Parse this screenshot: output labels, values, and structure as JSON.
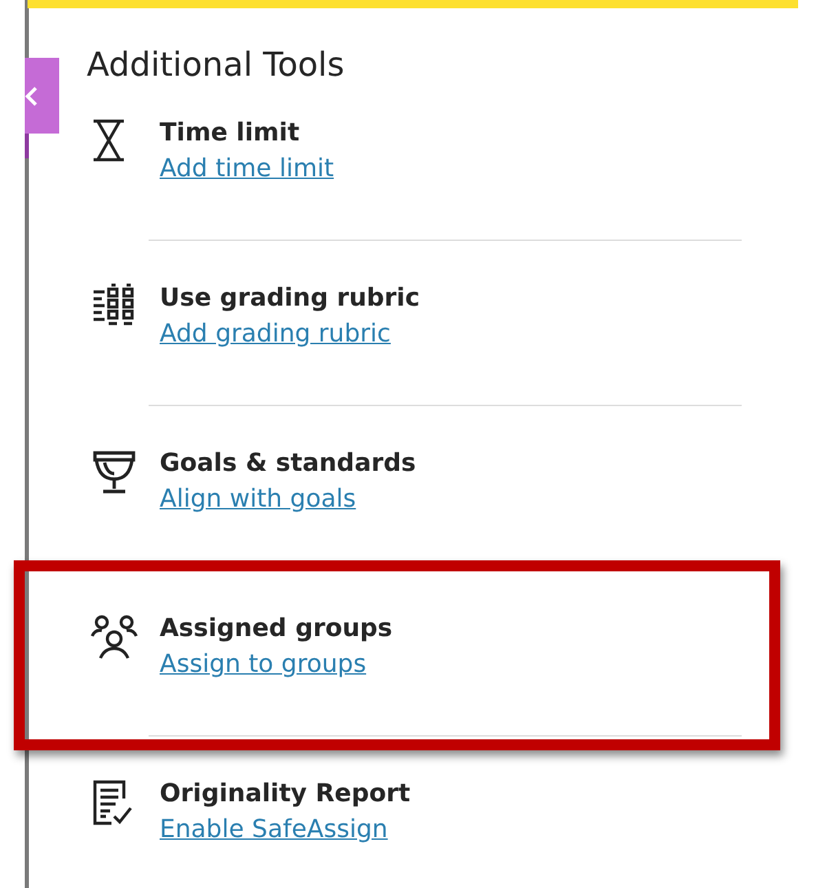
{
  "panel": {
    "title": "Additional Tools"
  },
  "tools": [
    {
      "kind": "hourglass",
      "title": "Time limit",
      "link": "Add time limit",
      "highlighted": false
    },
    {
      "kind": "rubric",
      "title": "Use grading rubric",
      "link": "Add grading rubric",
      "highlighted": false
    },
    {
      "kind": "trophy",
      "title": "Goals & standards",
      "link": "Align with goals",
      "highlighted": false
    },
    {
      "kind": "groups",
      "title": "Assigned groups",
      "link": "Assign to groups",
      "highlighted": true
    },
    {
      "kind": "report",
      "title": "Originality Report",
      "link": "Enable SafeAssign",
      "highlighted": false
    }
  ]
}
